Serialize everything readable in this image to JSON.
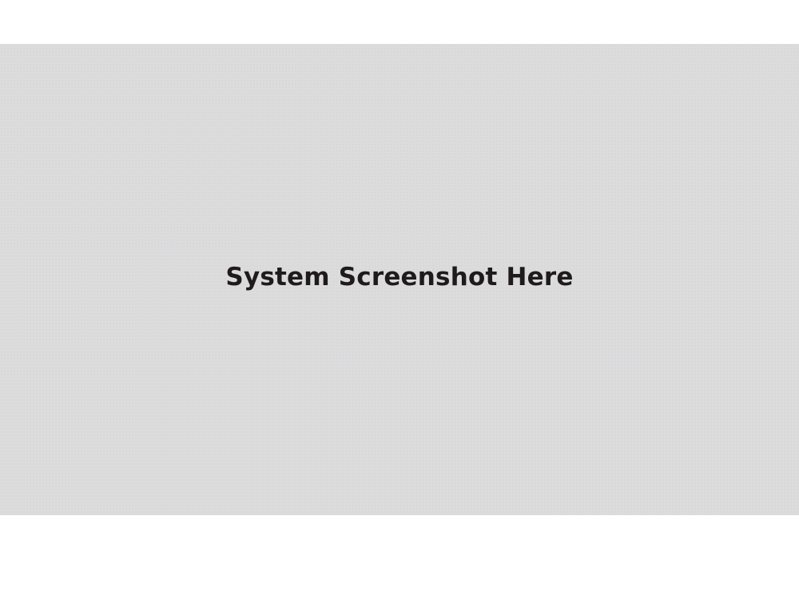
{
  "placeholder": {
    "text": "System Screenshot Here"
  },
  "colors": {
    "page_background": "#ffffff",
    "panel_background": "#dcdcdd",
    "text": "#1f1b1c"
  }
}
